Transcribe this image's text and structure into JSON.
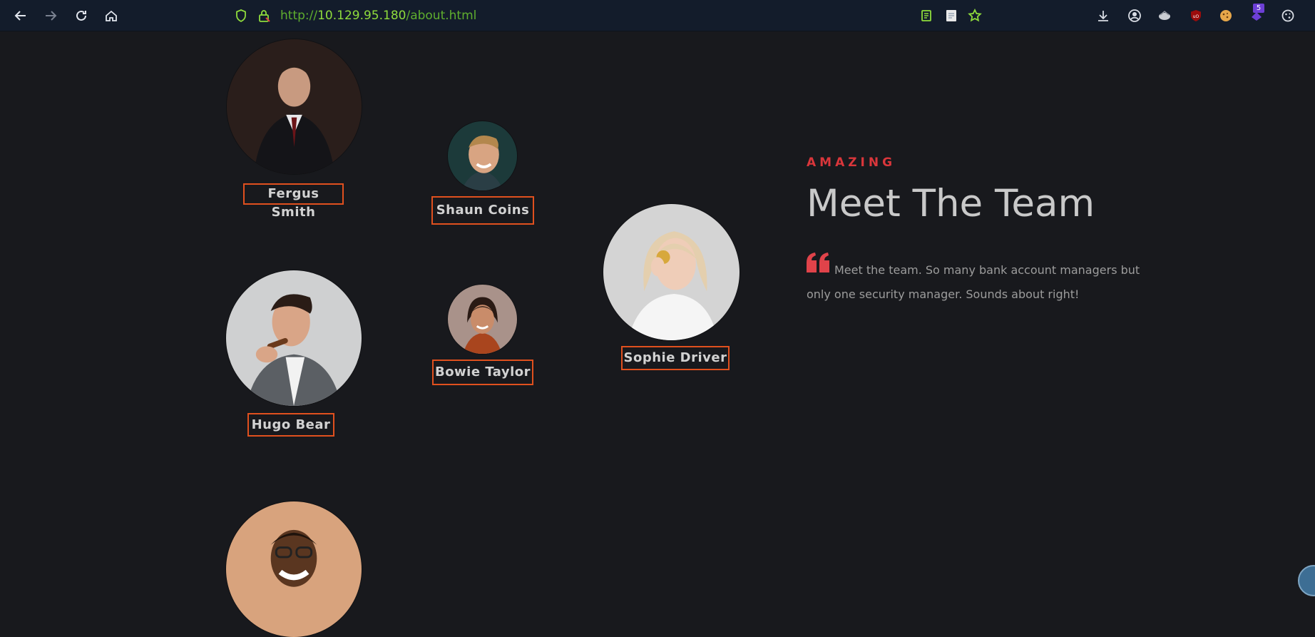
{
  "browser": {
    "url_prefix": "http://",
    "url_host": "10.129.95.180",
    "url_path": "/about.html",
    "badge_count": "5",
    "icons": [
      "back-icon",
      "forward-icon",
      "reload-icon",
      "home-icon",
      "shield-icon",
      "lock-icon",
      "reader-icon",
      "notes-icon",
      "bookmark-star-icon",
      "download-icon",
      "account-icon",
      "extension-icon",
      "ublock-icon",
      "cookie-icon",
      "extension-purple-icon",
      "settings-icon"
    ]
  },
  "team": {
    "members": [
      {
        "name": "Fergus Smith"
      },
      {
        "name": "Shaun Coins"
      },
      {
        "name": "Hugo Bear"
      },
      {
        "name": "Bowie Taylor"
      },
      {
        "name": "Sophie Driver"
      }
    ]
  },
  "hero": {
    "eyebrow": "AMAZING",
    "title": "Meet The Team",
    "quote": "Meet the team. So many bank account managers but only one security manager. Sounds about right!"
  },
  "colors": {
    "accent": "#d9363b",
    "name_border": "#e0501e",
    "background": "#18191d",
    "toolbar": "#131c2b"
  }
}
